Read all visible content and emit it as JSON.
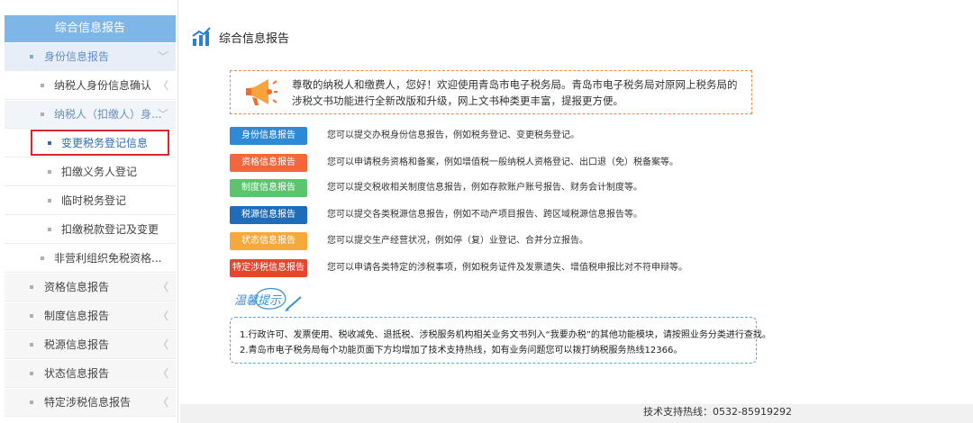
{
  "sidebar": {
    "header": "综合信息报告",
    "items": [
      {
        "label": "身份信息报告",
        "chevron": "﹀"
      },
      {
        "label": "纳税人身份信息确认",
        "chevron": "〈"
      },
      {
        "label": "纳税人（扣缴人）身...",
        "chevron": "﹀"
      },
      {
        "label": "变更税务登记信息"
      },
      {
        "label": "扣缴义务人登记"
      },
      {
        "label": "临时税务登记"
      },
      {
        "label": "扣缴税款登记及变更"
      },
      {
        "label": "非营利组织免税资格..."
      },
      {
        "label": "资格信息报告",
        "chevron": "〈"
      },
      {
        "label": "制度信息报告",
        "chevron": "〈"
      },
      {
        "label": "税源信息报告",
        "chevron": "〈"
      },
      {
        "label": "状态信息报告",
        "chevron": "〈"
      },
      {
        "label": "特定涉税信息报告",
        "chevron": "〈"
      }
    ]
  },
  "main": {
    "title": "综合信息报告",
    "title_icon": "chart-trend-icon",
    "welcome": {
      "icon": "megaphone-icon",
      "text": "尊敬的纳税人和缴费人，您好！欢迎使用青岛市电子税务局。青岛市电子税务局对原网上税务局的涉税文书功能进行全新改版和升级，网上文书种类更丰富，提报更方便。"
    },
    "categories": [
      {
        "label": "身份信息报告",
        "color": "#2f8ad6",
        "desc": "您可以提交办税身份信息报告，例如税务登记、变更税务登记。"
      },
      {
        "label": "资格信息报告",
        "color": "#f2683a",
        "desc": "您可以申请税务资格和备案，例如增值税一般纳税人资格登记、出口退（免）税备案等。"
      },
      {
        "label": "制度信息报告",
        "color": "#5cc46e",
        "desc": "您可以提交税收相关制度信息报告，例如存款账户账号报告、财务会计制度等。"
      },
      {
        "label": "税源信息报告",
        "color": "#1f6db8",
        "desc": "您可以提交各类税源信息报告，例如不动产项目报告、跨区域税源信息报告等。"
      },
      {
        "label": "状态信息报告",
        "color": "#f6a93b",
        "desc": "您可以提交生产经营状况，例如停（复）业登记、合并分立报告。"
      },
      {
        "label": "特定涉税信息报告",
        "color": "#e8452f",
        "desc": "您可以申请各类特定的涉税事项，例如税务证件及发票遗失、增值税申报比对不符申辩等。"
      }
    ],
    "tips": {
      "label": "温馨提示",
      "lines": [
        "1.行政许可、发票使用、税收减免、退抵税、涉税服务机构相关业务文书列入“我要办税”的其他功能模块，请按照业务分类进行查找。",
        "2.青岛市电子税务局每个功能页面下方均增加了技术支持热线，如有业务问题您可以拨打纳税服务热线12366。"
      ]
    }
  },
  "footer": {
    "text": "技术支持热线：0532-85919292"
  }
}
